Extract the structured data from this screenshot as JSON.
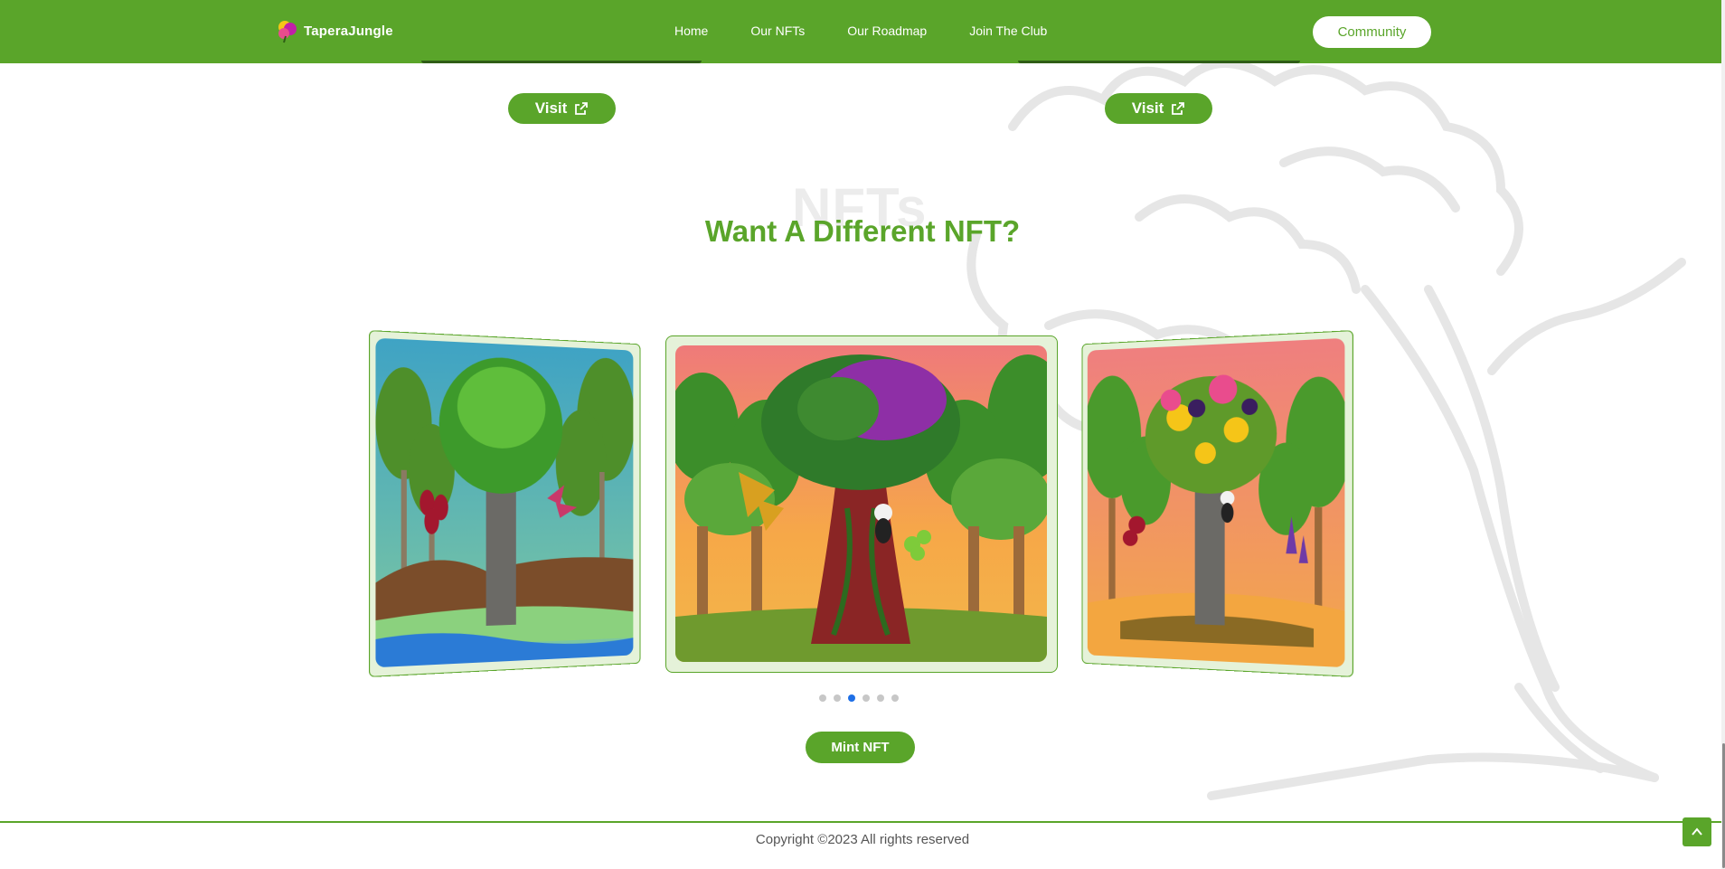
{
  "header": {
    "logo_text": "TaperaJungle",
    "nav": [
      "Home",
      "Our NFTs",
      "Our Roadmap",
      "Join The Club"
    ],
    "community_label": "Community"
  },
  "cards_above": {
    "visit_label": "Visit"
  },
  "section": {
    "watermark": "NFTs",
    "title": "Want A Different NFT?"
  },
  "carousel": {
    "dot_count": 6,
    "active_index": 2
  },
  "mint_label": "Mint NFT",
  "footer": {
    "copyright": "Copyright ©2023 All rights reserved"
  },
  "colors": {
    "brand_green": "#5aa52a",
    "active_dot": "#1e6fe6"
  }
}
